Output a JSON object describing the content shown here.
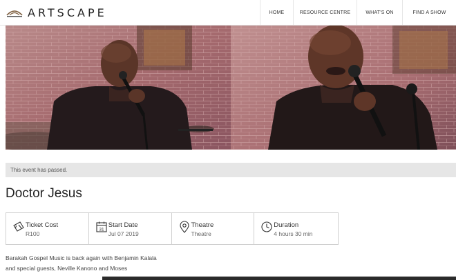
{
  "header": {
    "logo_text": "ARTSCAPE",
    "nav": [
      {
        "label": "HOME"
      },
      {
        "label": "RESOURCE CENTRE"
      },
      {
        "label": "WHAT'S ON"
      },
      {
        "label": "FIND A SHOW"
      }
    ]
  },
  "event": {
    "notice": "This event has passed.",
    "title": "Doctor Jesus",
    "info": [
      {
        "label": "Ticket Cost",
        "value": "R100",
        "icon": "ticket-icon"
      },
      {
        "label": "Start Date",
        "value": "Jul 07 2019",
        "icon": "calendar-icon"
      },
      {
        "label": "Theatre",
        "value": "Theatre",
        "icon": "location-pin-icon"
      },
      {
        "label": "Duration",
        "value": "4 hours 30 min",
        "icon": "clock-icon"
      }
    ],
    "description_lines": [
      "Barakah Gospel Music is back again with Benjamin Kalala",
      "and special guests, Neville Kanono and Moses"
    ]
  },
  "colors": {
    "notice_bg": "#e6e6e6",
    "border": "#cfcfcf",
    "text_dark": "#222222"
  }
}
